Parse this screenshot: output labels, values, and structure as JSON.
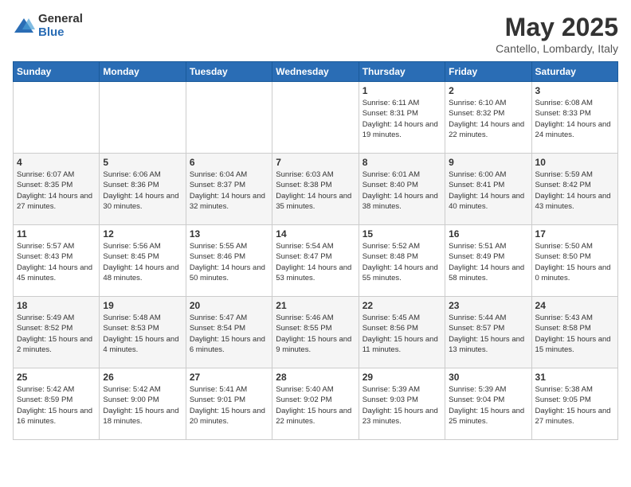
{
  "logo": {
    "general": "General",
    "blue": "Blue"
  },
  "title": "May 2025",
  "location": "Cantello, Lombardy, Italy",
  "days_header": [
    "Sunday",
    "Monday",
    "Tuesday",
    "Wednesday",
    "Thursday",
    "Friday",
    "Saturday"
  ],
  "weeks": [
    [
      {
        "day": "",
        "info": ""
      },
      {
        "day": "",
        "info": ""
      },
      {
        "day": "",
        "info": ""
      },
      {
        "day": "",
        "info": ""
      },
      {
        "day": "1",
        "info": "Sunrise: 6:11 AM\nSunset: 8:31 PM\nDaylight: 14 hours\nand 19 minutes."
      },
      {
        "day": "2",
        "info": "Sunrise: 6:10 AM\nSunset: 8:32 PM\nDaylight: 14 hours\nand 22 minutes."
      },
      {
        "day": "3",
        "info": "Sunrise: 6:08 AM\nSunset: 8:33 PM\nDaylight: 14 hours\nand 24 minutes."
      }
    ],
    [
      {
        "day": "4",
        "info": "Sunrise: 6:07 AM\nSunset: 8:35 PM\nDaylight: 14 hours\nand 27 minutes."
      },
      {
        "day": "5",
        "info": "Sunrise: 6:06 AM\nSunset: 8:36 PM\nDaylight: 14 hours\nand 30 minutes."
      },
      {
        "day": "6",
        "info": "Sunrise: 6:04 AM\nSunset: 8:37 PM\nDaylight: 14 hours\nand 32 minutes."
      },
      {
        "day": "7",
        "info": "Sunrise: 6:03 AM\nSunset: 8:38 PM\nDaylight: 14 hours\nand 35 minutes."
      },
      {
        "day": "8",
        "info": "Sunrise: 6:01 AM\nSunset: 8:40 PM\nDaylight: 14 hours\nand 38 minutes."
      },
      {
        "day": "9",
        "info": "Sunrise: 6:00 AM\nSunset: 8:41 PM\nDaylight: 14 hours\nand 40 minutes."
      },
      {
        "day": "10",
        "info": "Sunrise: 5:59 AM\nSunset: 8:42 PM\nDaylight: 14 hours\nand 43 minutes."
      }
    ],
    [
      {
        "day": "11",
        "info": "Sunrise: 5:57 AM\nSunset: 8:43 PM\nDaylight: 14 hours\nand 45 minutes."
      },
      {
        "day": "12",
        "info": "Sunrise: 5:56 AM\nSunset: 8:45 PM\nDaylight: 14 hours\nand 48 minutes."
      },
      {
        "day": "13",
        "info": "Sunrise: 5:55 AM\nSunset: 8:46 PM\nDaylight: 14 hours\nand 50 minutes."
      },
      {
        "day": "14",
        "info": "Sunrise: 5:54 AM\nSunset: 8:47 PM\nDaylight: 14 hours\nand 53 minutes."
      },
      {
        "day": "15",
        "info": "Sunrise: 5:52 AM\nSunset: 8:48 PM\nDaylight: 14 hours\nand 55 minutes."
      },
      {
        "day": "16",
        "info": "Sunrise: 5:51 AM\nSunset: 8:49 PM\nDaylight: 14 hours\nand 58 minutes."
      },
      {
        "day": "17",
        "info": "Sunrise: 5:50 AM\nSunset: 8:50 PM\nDaylight: 15 hours\nand 0 minutes."
      }
    ],
    [
      {
        "day": "18",
        "info": "Sunrise: 5:49 AM\nSunset: 8:52 PM\nDaylight: 15 hours\nand 2 minutes."
      },
      {
        "day": "19",
        "info": "Sunrise: 5:48 AM\nSunset: 8:53 PM\nDaylight: 15 hours\nand 4 minutes."
      },
      {
        "day": "20",
        "info": "Sunrise: 5:47 AM\nSunset: 8:54 PM\nDaylight: 15 hours\nand 6 minutes."
      },
      {
        "day": "21",
        "info": "Sunrise: 5:46 AM\nSunset: 8:55 PM\nDaylight: 15 hours\nand 9 minutes."
      },
      {
        "day": "22",
        "info": "Sunrise: 5:45 AM\nSunset: 8:56 PM\nDaylight: 15 hours\nand 11 minutes."
      },
      {
        "day": "23",
        "info": "Sunrise: 5:44 AM\nSunset: 8:57 PM\nDaylight: 15 hours\nand 13 minutes."
      },
      {
        "day": "24",
        "info": "Sunrise: 5:43 AM\nSunset: 8:58 PM\nDaylight: 15 hours\nand 15 minutes."
      }
    ],
    [
      {
        "day": "25",
        "info": "Sunrise: 5:42 AM\nSunset: 8:59 PM\nDaylight: 15 hours\nand 16 minutes."
      },
      {
        "day": "26",
        "info": "Sunrise: 5:42 AM\nSunset: 9:00 PM\nDaylight: 15 hours\nand 18 minutes."
      },
      {
        "day": "27",
        "info": "Sunrise: 5:41 AM\nSunset: 9:01 PM\nDaylight: 15 hours\nand 20 minutes."
      },
      {
        "day": "28",
        "info": "Sunrise: 5:40 AM\nSunset: 9:02 PM\nDaylight: 15 hours\nand 22 minutes."
      },
      {
        "day": "29",
        "info": "Sunrise: 5:39 AM\nSunset: 9:03 PM\nDaylight: 15 hours\nand 23 minutes."
      },
      {
        "day": "30",
        "info": "Sunrise: 5:39 AM\nSunset: 9:04 PM\nDaylight: 15 hours\nand 25 minutes."
      },
      {
        "day": "31",
        "info": "Sunrise: 5:38 AM\nSunset: 9:05 PM\nDaylight: 15 hours\nand 27 minutes."
      }
    ]
  ]
}
